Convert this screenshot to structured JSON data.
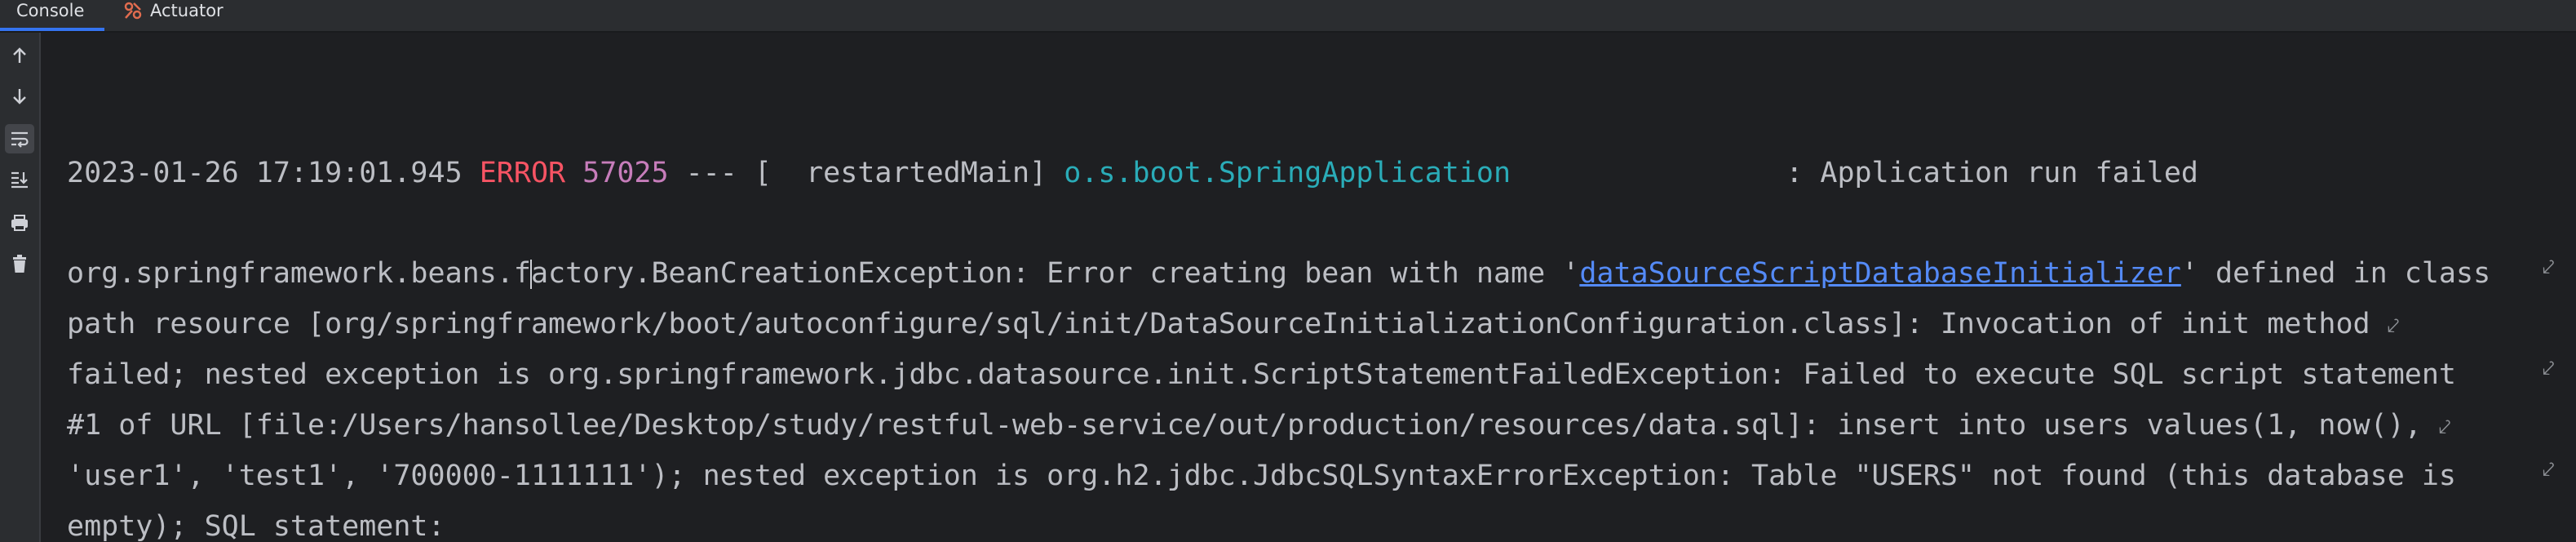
{
  "tabs": [
    {
      "label": "Console",
      "active": true
    },
    {
      "label": "Actuator",
      "active": false
    }
  ],
  "toolbar": {
    "icons": [
      "arrow-up-icon",
      "arrow-down-icon",
      "soft-wrap-icon",
      "scroll-to-end-icon",
      "print-icon",
      "trash-icon"
    ]
  },
  "colors": {
    "error": "#f75464",
    "pid": "#c77dbb",
    "logger": "#2aacb8",
    "link": "#548af7",
    "text": "#bcbec4"
  },
  "log": {
    "timestamp": "2023-01-26 17:19:01.945",
    "level": "ERROR",
    "pid": "57025",
    "separator": " --- [",
    "thread": "  restartedMain]",
    "logger": "o.s.boot.SpringApplication",
    "message": ": Application run failed"
  },
  "exception": {
    "line1_a": "org.springframework.beans.f",
    "line1_b": "actory.BeanCreationException: Error creating bean with name '",
    "bean_link": "dataSourceScriptDatabaseInitializer",
    "line1_c": "' defined in class",
    "line2": "path resource [org/springframework/boot/autoconfigure/sql/init/DataSourceInitializationConfiguration.class]: Invocation of init method",
    "line3": "failed; nested exception is org.springframework.jdbc.datasource.init.ScriptStatementFailedException: Failed to execute SQL script statement",
    "line4": "#1 of URL [file:/Users/hansollee/Desktop/study/restful-web-service/out/production/resources/data.sql]: insert into users values(1, now(),",
    "line5": "'user1', 'test1', '700000-1111111'); nested exception is org.h2.jdbc.JdbcSQLSyntaxErrorException: Table \"USERS\" not found (this database is",
    "line6": "empty); SQL statement:"
  }
}
